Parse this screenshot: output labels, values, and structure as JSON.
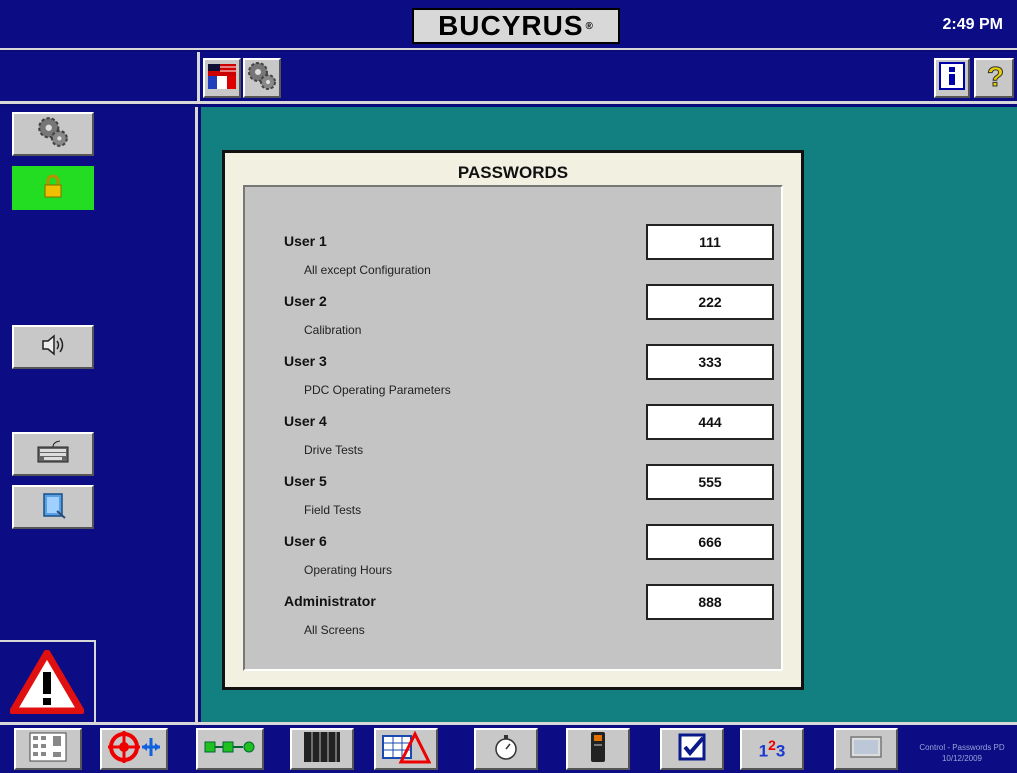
{
  "header": {
    "logo_text": "BUCYRUS",
    "logo_mark": "®",
    "time": "2:49 PM"
  },
  "toolbar": {
    "left_icons": [
      "language-flag-icon",
      "gears-icon"
    ],
    "right_icons": [
      "info-icon",
      "help-icon"
    ]
  },
  "sidebar": {
    "items": [
      "gears-icon",
      "lock-icon",
      "speaker-icon",
      "keyboard-icon",
      "book-icon"
    ],
    "active_color": "#22dd22"
  },
  "panel": {
    "title": "PASSWORDS",
    "users": [
      {
        "label": "User 1",
        "desc": "All except Configuration",
        "password": "111"
      },
      {
        "label": "User 2",
        "desc": "Calibration",
        "password": "222"
      },
      {
        "label": "User 3",
        "desc": "PDC Operating Parameters",
        "password": "333"
      },
      {
        "label": "User 4",
        "desc": "Drive Tests",
        "password": "444"
      },
      {
        "label": "User 5",
        "desc": "Field Tests",
        "password": "555"
      },
      {
        "label": "User 6",
        "desc": "Operating Hours",
        "password": "666"
      },
      {
        "label": "Administrator",
        "desc": "All Screens",
        "password": "888"
      }
    ]
  },
  "bottom_nav": {
    "icons": [
      "panel-grid-icon",
      "target-move-icon",
      "chain-icon",
      "cabinet-icon",
      "chart-warning-icon",
      "stopwatch-icon",
      "handheld-device-icon",
      "checkbox-icon",
      "numbers-icon",
      "screen-icon"
    ],
    "numbers_text": [
      "1",
      "2",
      "3"
    ]
  },
  "footer": {
    "line1": "Control - Passwords PD",
    "line2": "10/12/2009"
  },
  "colors": {
    "background_blue": "#0c0c84",
    "main_teal": "#128080",
    "button_gray": "#c8c8c8"
  }
}
